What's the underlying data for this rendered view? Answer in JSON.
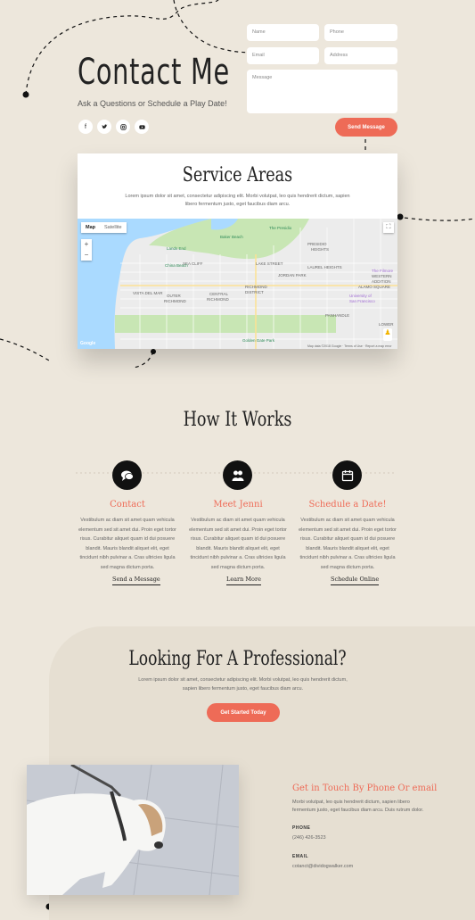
{
  "contact": {
    "title": "Contact Me",
    "subtitle": "Ask a Questions or Schedule a Play Date!",
    "social_icons": [
      "facebook-icon",
      "twitter-icon",
      "instagram-icon",
      "youtube-icon"
    ]
  },
  "form": {
    "name_placeholder": "Name",
    "phone_placeholder": "Phone",
    "email_placeholder": "Email",
    "address_placeholder": "Address",
    "message_placeholder": "Message",
    "send_label": "Send Message"
  },
  "service": {
    "title": "Service Areas",
    "text": "Lorem ipsum dolor sit amet, consectetur adipiscing elit. Morbi volutpat, leo quis hendrerit dictum, sapien libero fermentum justo, eget faucibus diam arcu.",
    "map": {
      "tab_map": "Map",
      "tab_satellite": "Satellite",
      "zoom_in": "+",
      "zoom_out": "−",
      "brand": "Google",
      "districts": [
        "SEA CLIFF",
        "LAKE STREET",
        "LAUREL HEIGHTS",
        "JORDAN PARK",
        "VISTA DEL MAR",
        "OUTER RICHMOND",
        "CENTRAL RICHMOND",
        "RICHMOND DISTRICT",
        "PRESIDIO HEIGHTS",
        "WESTERN ADDITION",
        "ALAMO SQUARE",
        "PANHANDLE",
        "LOWER"
      ],
      "places": [
        "Lands End",
        "Baker Beach",
        "China Beach",
        "The Presidio",
        "The Filmore",
        "Golden Gate Park",
        "University of San Francisco"
      ]
    }
  },
  "how": {
    "title": "How It Works",
    "steps": [
      {
        "icon": "chat-icon",
        "title": "Contact",
        "text": "Vestibulum ac diam sit amet quam vehicula elementum sed sit amet dui. Proin eget tortor risus. Curabitur aliquet quam id dui posuere blandit. Mauris blandit aliquet elit, eget tincidunt nibh pulvinar a. Cras ultricies ligula sed magna dictum porta.",
        "link": "Send a Message"
      },
      {
        "icon": "people-icon",
        "title": "Meet Jenni",
        "text": "Vestibulum ac diam sit amet quam vehicula elementum sed sit amet dui. Proin eget tortor risus. Curabitur aliquet quam id dui posuere blandit. Mauris blandit aliquet elit, eget tincidunt nibh pulvinar a. Cras ultricies ligula sed magna dictum porta.",
        "link": "Learn More"
      },
      {
        "icon": "calendar-icon",
        "title": "Schedule a Date!",
        "text": "Vestibulum ac diam sit amet quam vehicula elementum sed sit amet dui. Proin eget tortor risus. Curabitur aliquet quam id dui posuere blandit. Mauris blandit aliquet elit, eget tincidunt nibh pulvinar a. Cras ultricies ligula sed magna dictum porta.",
        "link": "Schedule Online"
      }
    ]
  },
  "pro": {
    "title": "Looking For A Professional?",
    "text": "Lorem ipsum dolor sit amet, consectetur adipiscing elit. Morbi volutpat, leo quis hendrerit dictum, sapien libero fermentum justo, eget faucibus diam arcu.",
    "button": "Get Started Today"
  },
  "get_in_touch": {
    "title": "Get in Touch By Phone Or email",
    "text": "Morbi volutpat, leo quis hendrerit dictum, sapien libero fermentum justo, eget faucibus diam arcu. Duis rutrum dolor.",
    "phone_label": "PHONE",
    "phone": "(246) 426-3523",
    "email_label": "EMAIL",
    "email": "cotanct@dividogwalker.com"
  },
  "colors": {
    "accent": "#ee6b57",
    "background": "#ede7dc",
    "icon_bg": "#111111"
  }
}
